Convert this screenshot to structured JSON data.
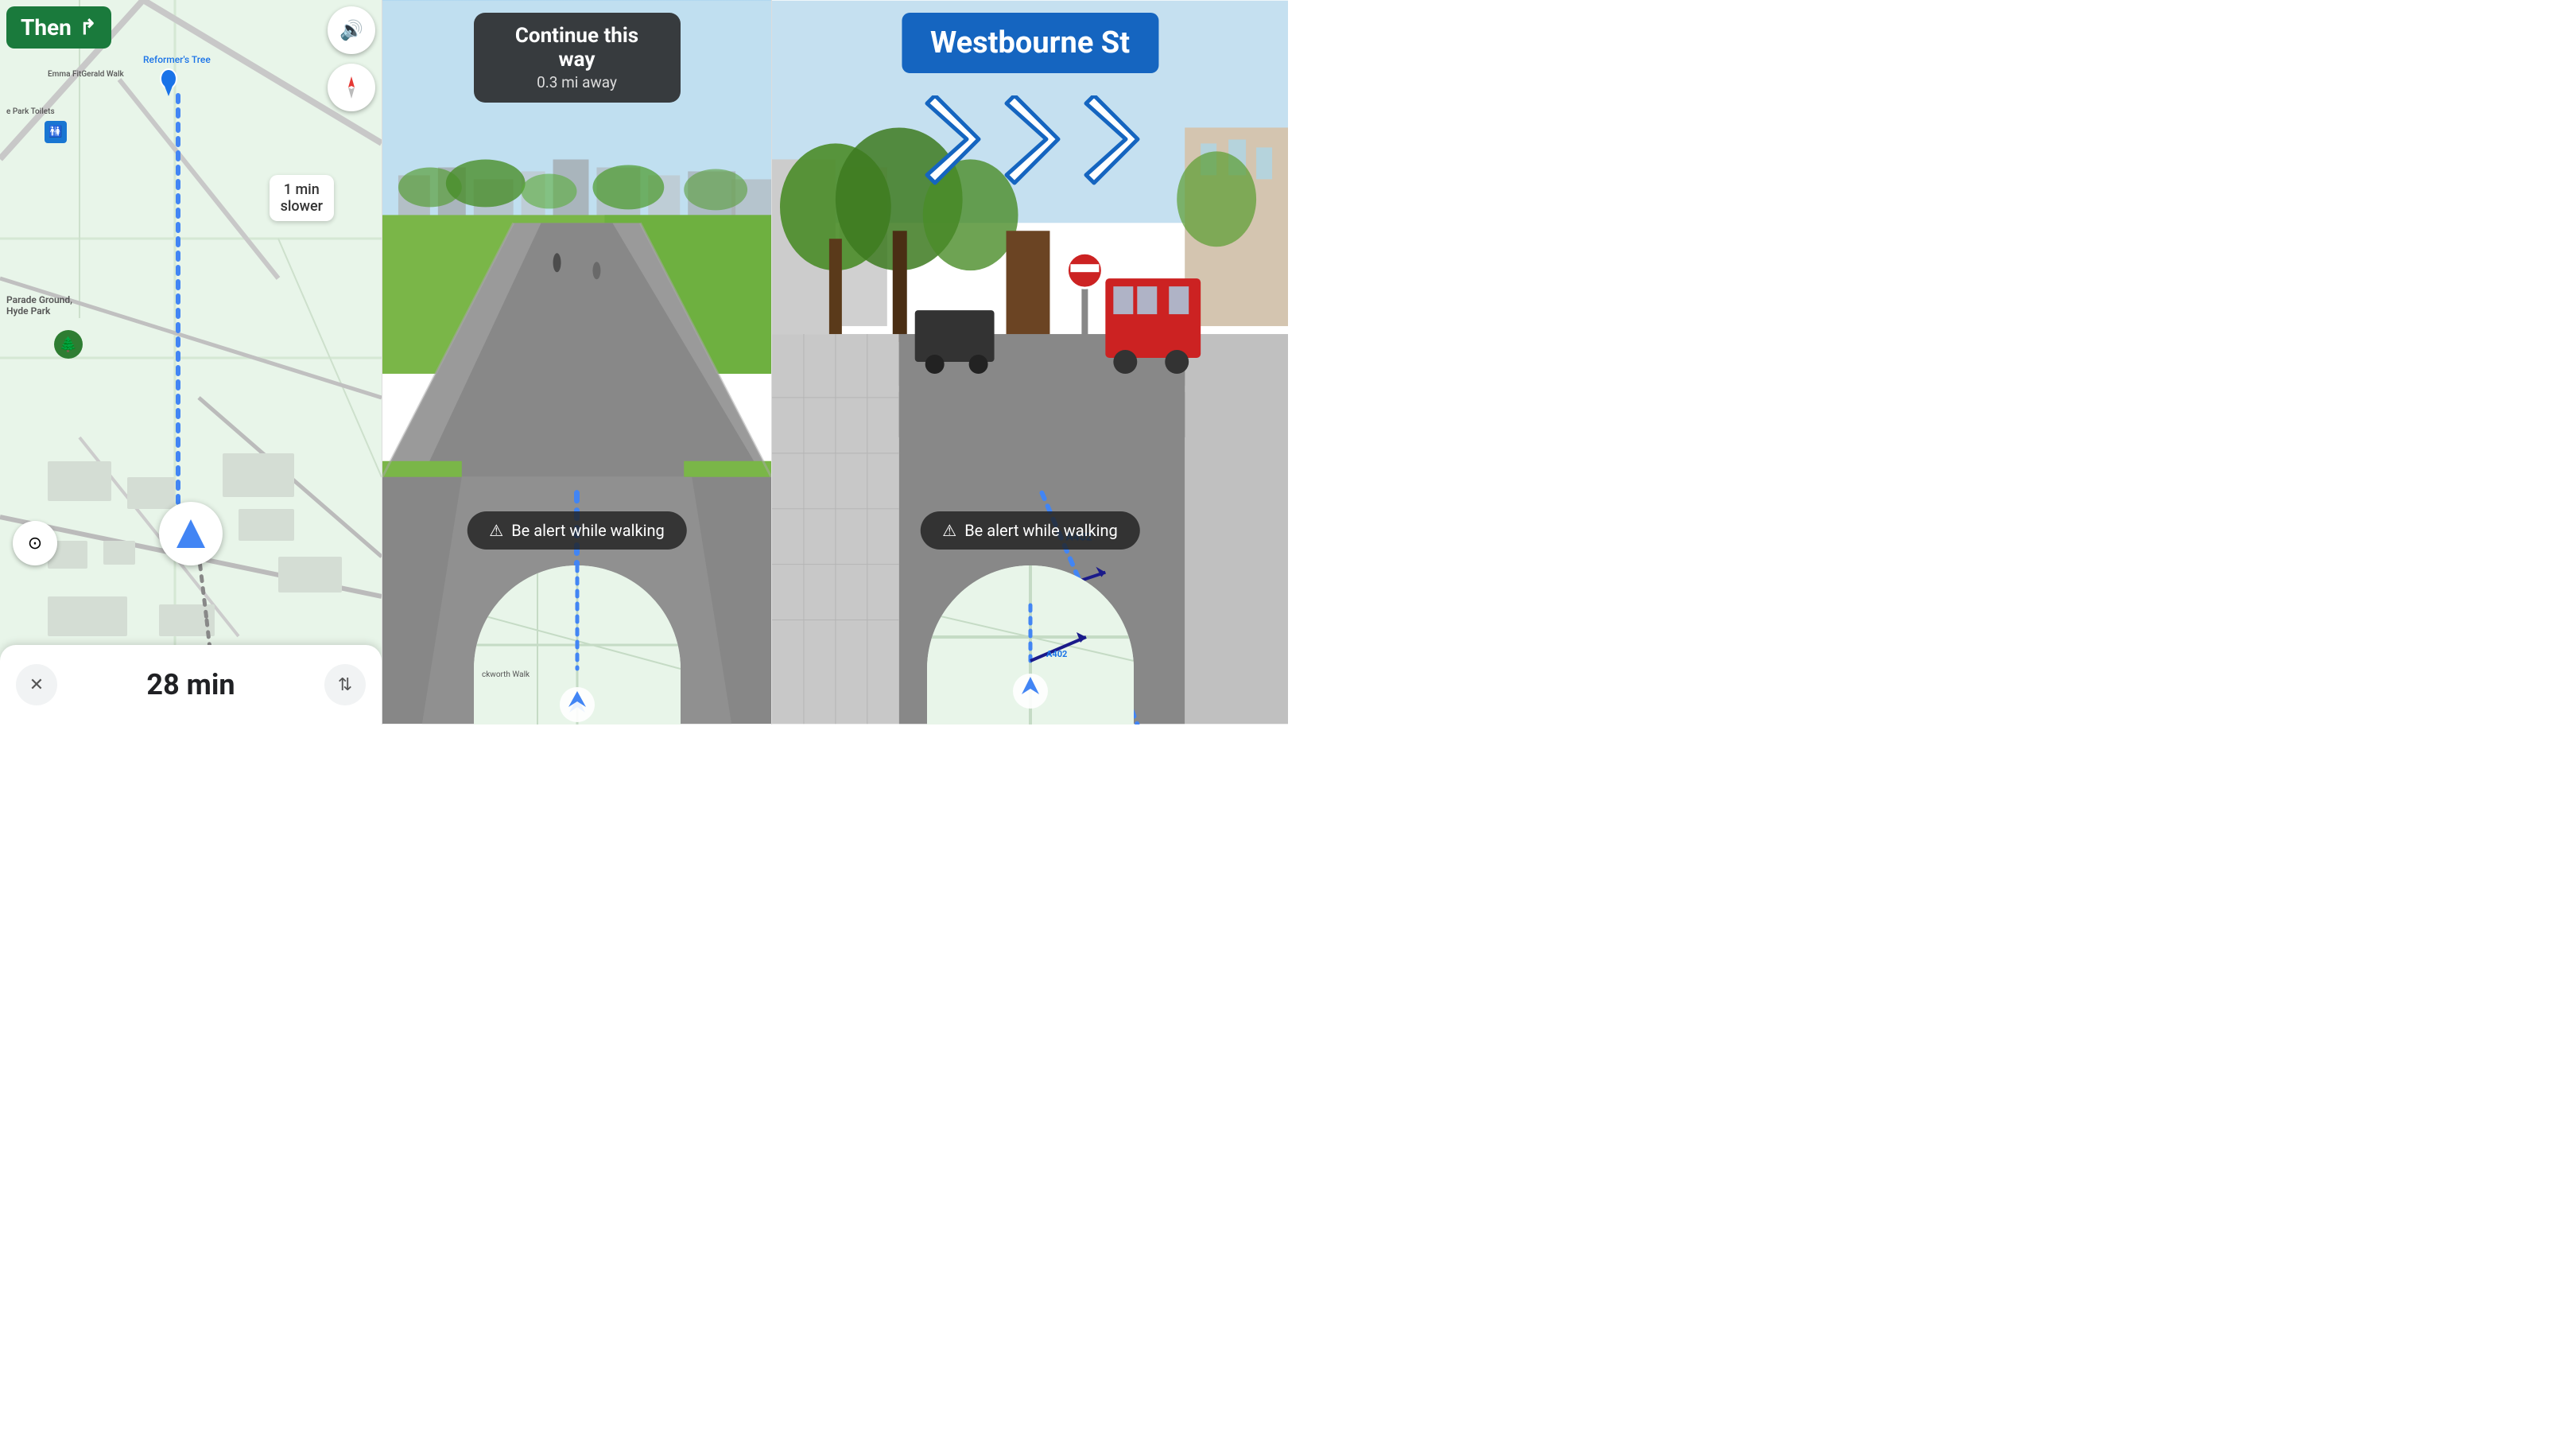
{
  "left_panel": {
    "then_label": "Then",
    "time_display": "28 min",
    "slower_label": "1 min\nslower",
    "map_labels": [
      "Reformer's Tree",
      "Emma FitGerald Walk",
      "Park Toilets",
      "Parade Ground,\nHyde Park"
    ],
    "sound_icon": "🔊",
    "compass_icon": "🧭",
    "close_icon": "✕",
    "swap_icon": "⇅",
    "recenter_icon": "⊙"
  },
  "middle_panel": {
    "continue_main": "Continue this way",
    "continue_sub": "0.3 mi away",
    "alert_text": "Be alert while walking",
    "map_label": "ckworth Walk"
  },
  "right_panel": {
    "street_name": "Westbourne St",
    "alert_text": "Be alert while walking",
    "map_label": "A402"
  },
  "colors": {
    "then_green": "#1a7a3c",
    "blue": "#1565c0",
    "route_blue": "#4285f4",
    "map_green": "#e8f5e9"
  }
}
